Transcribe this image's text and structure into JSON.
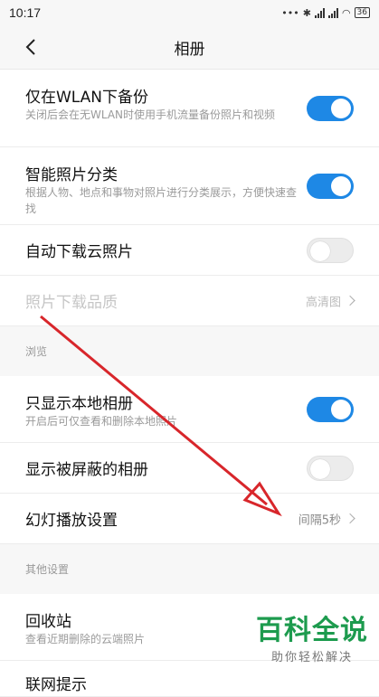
{
  "status": {
    "time": "10:17",
    "dots": "•••",
    "battery": "36"
  },
  "header": {
    "title": "相册"
  },
  "settings1": [
    {
      "label": "仅在WLAN下备份",
      "desc": "关闭后会在无WLAN时使用手机流量备份照片和视频",
      "toggle": "on"
    },
    {
      "label": "智能照片分类",
      "desc": "根据人物、地点和事物对照片进行分类展示，方便快速查找",
      "toggle": "on"
    },
    {
      "label": "自动下载云照片",
      "toggle": "off"
    },
    {
      "label": "照片下载品质",
      "value": "高清图",
      "disabled": true
    }
  ],
  "browse": {
    "heading": "浏览",
    "items": [
      {
        "label": "只显示本地相册",
        "desc": "开启后可仅查看和删除本地照片",
        "toggle": "on"
      },
      {
        "label": "显示被屏蔽的相册",
        "toggle": "off"
      },
      {
        "label": "幻灯播放设置",
        "value": "间隔5秒"
      }
    ]
  },
  "other": {
    "heading": "其他设置",
    "items": [
      {
        "label": "回收站",
        "desc": "查看近期删除的云端照片"
      },
      {
        "label": "联网提示"
      }
    ]
  },
  "watermark": {
    "main": "百科全说",
    "sub": "助你轻松解决"
  },
  "colors": {
    "toggle_on": "#1e88e5",
    "arrow": "#d8262b",
    "watermark": "#1d9b4e"
  }
}
